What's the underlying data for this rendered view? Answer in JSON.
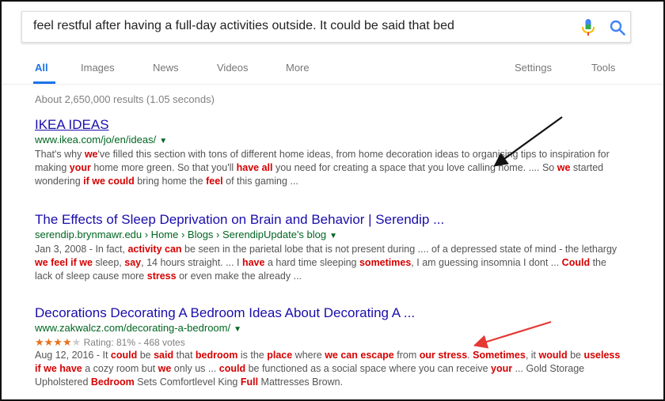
{
  "search": {
    "query": "feel restful after having a full-day activities outside. It could be said that bed"
  },
  "tabs": [
    {
      "label": "All",
      "active": true
    },
    {
      "label": "Images"
    },
    {
      "label": "News"
    },
    {
      "label": "Videos"
    },
    {
      "label": "More"
    },
    {
      "label": "Settings"
    },
    {
      "label": "Tools"
    }
  ],
  "stats": "About 2,650,000 results (1.05 seconds)",
  "results": [
    {
      "title": "IKEA IDEAS",
      "url": "www.ikea.com/jo/en/ideas/",
      "snippet": [
        [
          "That's why ",
          ""
        ],
        [
          "we",
          "hl"
        ],
        [
          "'ve filled this section with tons of different home ideas, from home decoration ideas to organising tips to inspiration for making ",
          ""
        ],
        [
          "your",
          "hl"
        ],
        [
          " home more green. So that you'll ",
          ""
        ],
        [
          "have all",
          "hl"
        ],
        [
          " you need for creating a space that you love calling home. .... So ",
          ""
        ],
        [
          "we",
          "hl"
        ],
        [
          " started wondering ",
          ""
        ],
        [
          "if we could",
          "hl"
        ],
        [
          " bring home the ",
          ""
        ],
        [
          "feel",
          "hl"
        ],
        [
          " of this gaming ...",
          ""
        ]
      ]
    },
    {
      "title": "The Effects of Sleep Deprivation on Brain and Behavior | Serendip ...",
      "url": "serendip.brynmawr.edu › Home › Blogs › SerendipUpdate's blog",
      "snippet": [
        [
          "Jan 3, 2008 - In fact, ",
          ""
        ],
        [
          "activity can",
          "hl"
        ],
        [
          " be seen in the parietal lobe that is not present during .... of a depressed state of mind - the lethargy ",
          ""
        ],
        [
          "we feel if we",
          "hl"
        ],
        [
          " sleep, ",
          ""
        ],
        [
          "say",
          "hl"
        ],
        [
          ", 14 hours straight. ... I ",
          ""
        ],
        [
          "have",
          "hl"
        ],
        [
          " a hard time sleeping ",
          ""
        ],
        [
          "sometimes",
          "hl"
        ],
        [
          ", I am guessing insomnia I dont ... ",
          ""
        ],
        [
          "Could",
          "hl"
        ],
        [
          " the lack of sleep cause more ",
          ""
        ],
        [
          "stress",
          "hl"
        ],
        [
          " or even make the already ...",
          ""
        ]
      ]
    },
    {
      "title": "Decorations Decorating A Bedroom Ideas About Decorating A ...",
      "url": "www.zakwalcz.com/decorating-a-bedroom/",
      "rating": {
        "stars": 4,
        "max": 5,
        "text": "Rating: 81% - 468 votes"
      },
      "snippet": [
        [
          "Aug 12, 2016 - It ",
          ""
        ],
        [
          "could",
          "hl"
        ],
        [
          " be ",
          ""
        ],
        [
          "said",
          "hl"
        ],
        [
          " that ",
          ""
        ],
        [
          "bedroom",
          "hl"
        ],
        [
          " is the ",
          ""
        ],
        [
          "place",
          "hl"
        ],
        [
          " where ",
          ""
        ],
        [
          "we can escape",
          "hl"
        ],
        [
          " from ",
          ""
        ],
        [
          "our stress",
          "hl"
        ],
        [
          ". ",
          ""
        ],
        [
          "Sometimes",
          "hl"
        ],
        [
          ", it ",
          ""
        ],
        [
          "would",
          "hl"
        ],
        [
          " be ",
          ""
        ],
        [
          "useless if we have",
          "hl"
        ],
        [
          " a cozy room but ",
          ""
        ],
        [
          "we",
          "hl"
        ],
        [
          " only us ... ",
          ""
        ],
        [
          "could",
          "hl"
        ],
        [
          " be functioned as a social space where you can receive ",
          ""
        ],
        [
          "your",
          "hl"
        ],
        [
          " ... Gold Storage Upholstered ",
          ""
        ],
        [
          "Bedroom",
          "hl"
        ],
        [
          " Sets Comfortlevel King ",
          ""
        ],
        [
          "Full",
          "hl"
        ],
        [
          " Mattresses Brown.",
          ""
        ]
      ]
    }
  ],
  "colors": {
    "link": "#1a0dab",
    "url": "#006621",
    "highlight": "#d50000",
    "active_tab": "#1a73e8",
    "annotation_black": "#111111",
    "annotation_red": "#e53935"
  },
  "icons": {
    "mic": "mic-icon",
    "search": "search-icon"
  }
}
